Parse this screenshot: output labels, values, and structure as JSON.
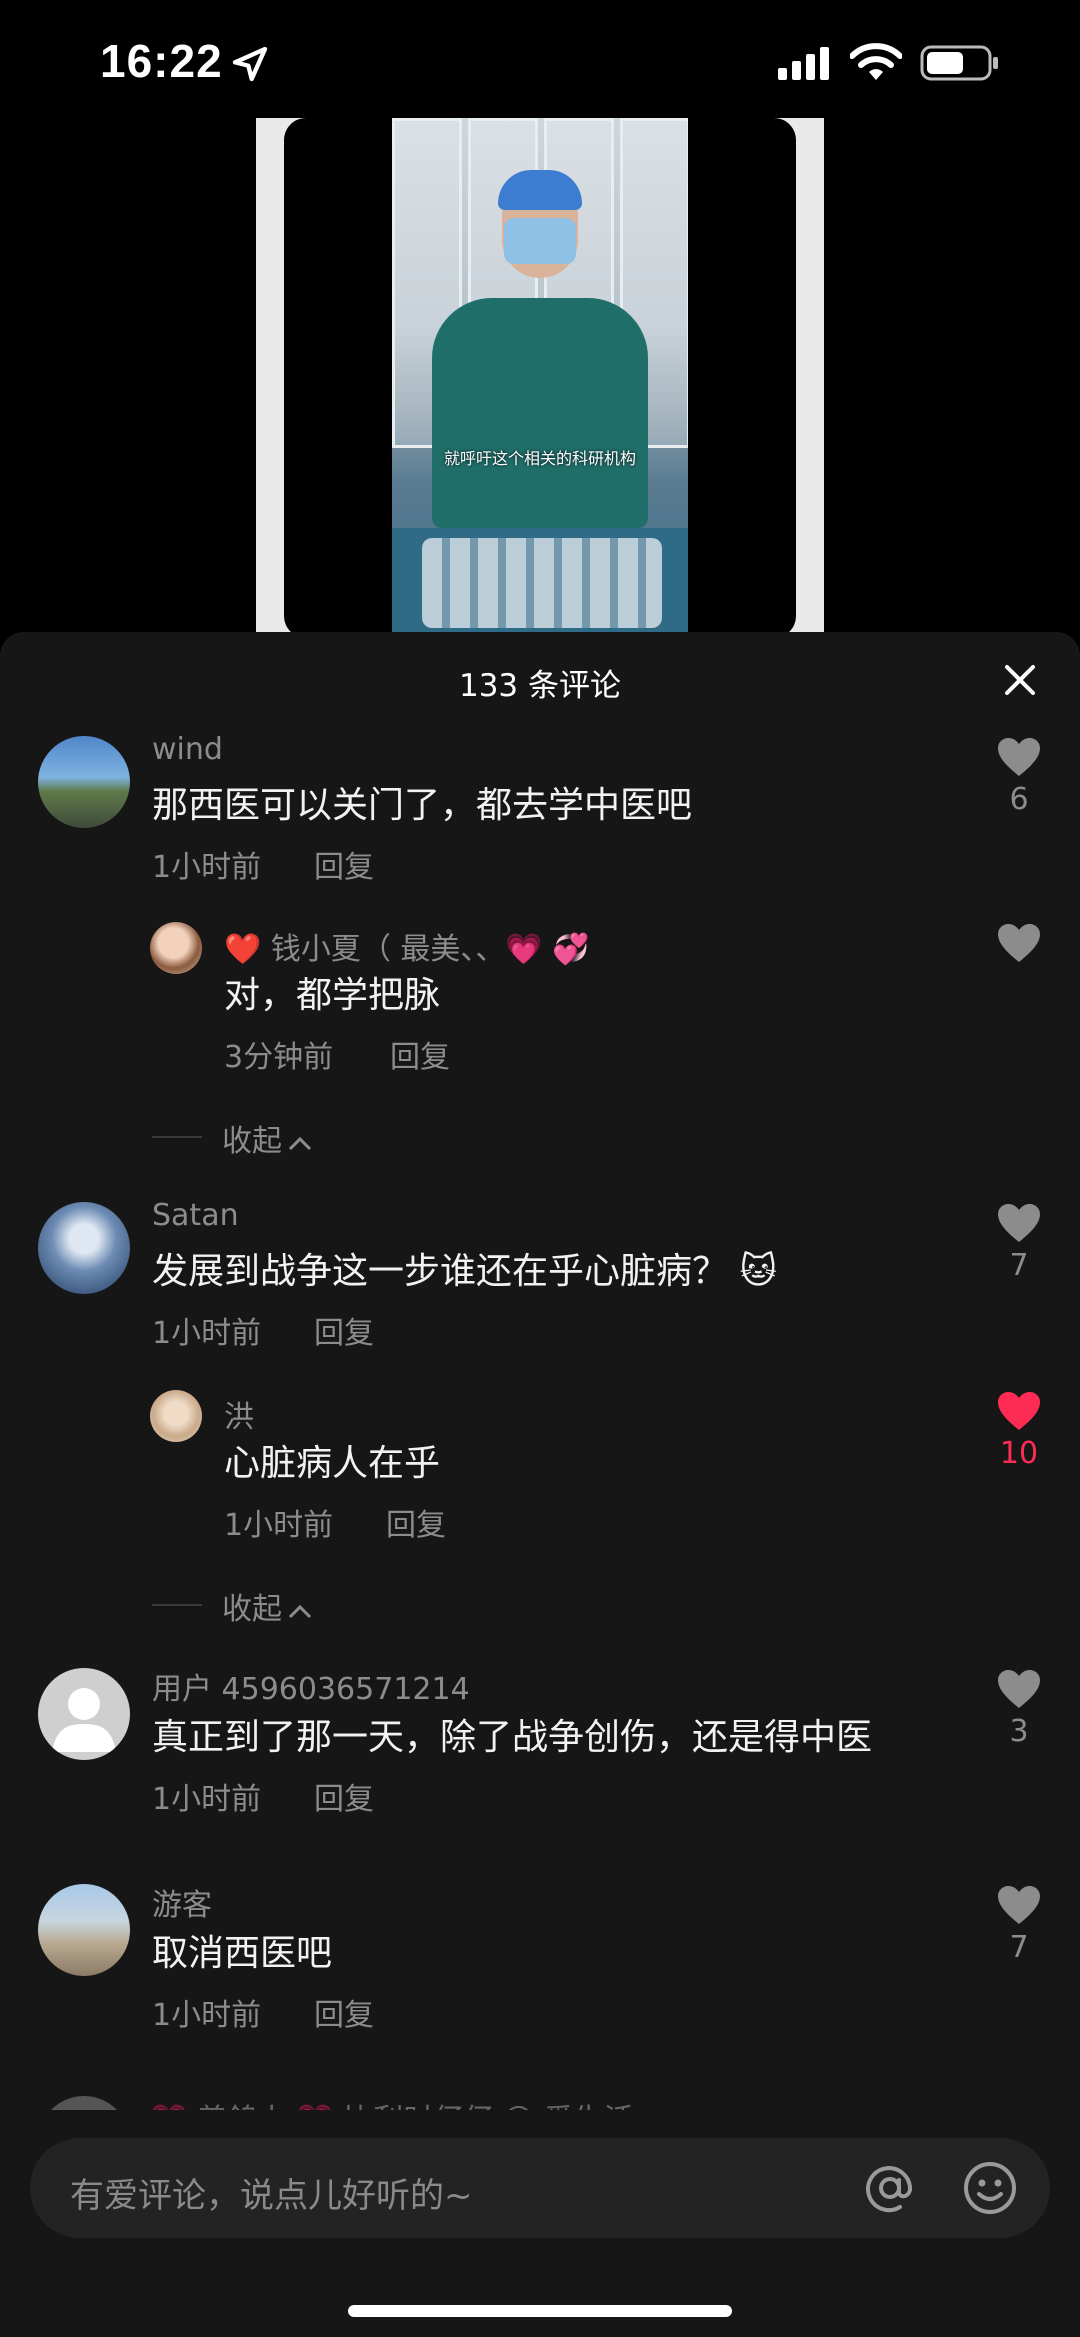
{
  "status_bar": {
    "time": "16:22"
  },
  "sheet": {
    "title": "133 条评论"
  },
  "comments": [
    {
      "username": "wind",
      "text": "那西医可以关门了，都去学中医吧",
      "time": "1小时前",
      "reply_label": "回复",
      "likes": "6",
      "liked": false
    },
    {
      "username": "❤️ 钱小夏（ 最美、、💗 💞",
      "text": "对，都学把脉",
      "time": "3分钟前",
      "reply_label": "回复",
      "likes": "",
      "liked": false,
      "is_reply": true
    },
    {
      "collapse_label": "收起"
    },
    {
      "username": "Satan",
      "text": "发展到战争这一步谁还在乎心脏病？ 🐱",
      "time": "1小时前",
      "reply_label": "回复",
      "likes": "7",
      "liked": false
    },
    {
      "username": "洪",
      "text": "心脏病人在乎",
      "time": "1小时前",
      "reply_label": "回复",
      "likes": "10",
      "liked": true,
      "is_reply": true
    },
    {
      "collapse_label": "收起"
    },
    {
      "username": "用户 4596036571214",
      "text": "真正到了那一天，除了战争创伤，还是得中医",
      "time": "1小时前",
      "reply_label": "回复",
      "likes": "3",
      "liked": false
    },
    {
      "username": "游客",
      "text": "取消西医吧",
      "time": "1小时前",
      "reply_label": "回复",
      "likes": "7",
      "liked": false
    }
  ],
  "peek_comment": "💗 养鸽人 💗 比利时仔仔 😊 爱生活",
  "video": {
    "subtitle": "就呼吁这个相关的科研机构"
  },
  "input": {
    "placeholder": "有爱评论，说点儿好听的~"
  },
  "colors": {
    "accent_like": "#fe2c55",
    "sheet_bg": "#161616"
  }
}
